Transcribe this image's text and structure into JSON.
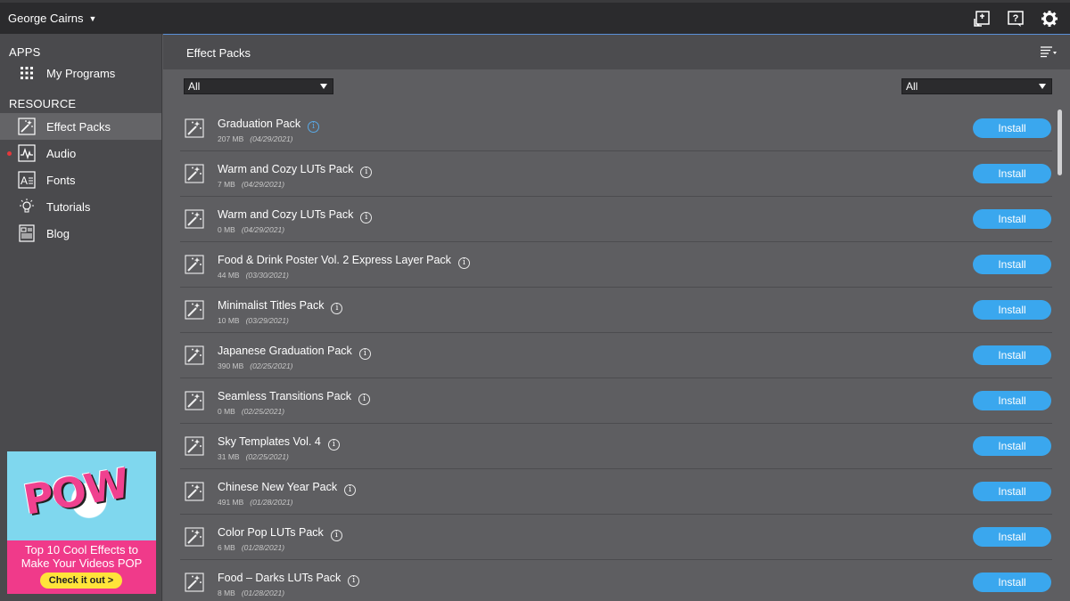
{
  "header": {
    "user_name": "George Cairns",
    "icons": [
      "import-icon",
      "help-icon",
      "gear-icon"
    ]
  },
  "sidebar": {
    "apps_heading": "APPS",
    "apps_items": [
      {
        "label": "My Programs",
        "icon": "grid-icon"
      }
    ],
    "resource_heading": "RESOURCE",
    "resource_items": [
      {
        "label": "Effect Packs",
        "icon": "magic-wand-icon",
        "active": true
      },
      {
        "label": "Audio",
        "icon": "audio-icon",
        "badge": true
      },
      {
        "label": "Fonts",
        "icon": "font-icon"
      },
      {
        "label": "Tutorials",
        "icon": "lightbulb-icon"
      },
      {
        "label": "Blog",
        "icon": "blog-icon"
      }
    ]
  },
  "promo": {
    "logo_text": "POW",
    "line1": "Top 10 Cool Effects to",
    "line2": "Make Your Videos POP",
    "cta": "Check it out >"
  },
  "main": {
    "title": "Effect Packs",
    "filter_left": "All",
    "filter_right": "All",
    "install_label": "Install",
    "packs": [
      {
        "name": "Graduation Pack",
        "size": "207 MB",
        "date": "(04/29/2021)",
        "info_highlight": true
      },
      {
        "name": "Warm and Cozy LUTs Pack",
        "size": "7 MB",
        "date": "(04/29/2021)"
      },
      {
        "name": "Warm and Cozy LUTs Pack",
        "size": "0 MB",
        "date": "(04/29/2021)"
      },
      {
        "name": "Food & Drink Poster Vol. 2 Express Layer Pack",
        "size": "44 MB",
        "date": "(03/30/2021)"
      },
      {
        "name": "Minimalist Titles Pack",
        "size": "10 MB",
        "date": "(03/29/2021)"
      },
      {
        "name": "Japanese Graduation Pack",
        "size": "390 MB",
        "date": "(02/25/2021)"
      },
      {
        "name": "Seamless Transitions Pack",
        "size": "0 MB",
        "date": "(02/25/2021)"
      },
      {
        "name": "Sky Templates Vol. 4",
        "size": "31 MB",
        "date": "(02/25/2021)"
      },
      {
        "name": "Chinese New Year Pack",
        "size": "491 MB",
        "date": "(01/28/2021)"
      },
      {
        "name": "Color Pop LUTs Pack",
        "size": "6 MB",
        "date": "(01/28/2021)"
      },
      {
        "name": "Food – Darks LUTs Pack",
        "size": "8 MB",
        "date": "(01/28/2021)"
      }
    ]
  },
  "colors": {
    "accent": "#3aa7ee",
    "topbar": "#2b2b2d",
    "sidebar": "#4a4a4d",
    "main": "#5e5e61",
    "badge": "#e5383b",
    "promo": "#f03a8a"
  }
}
